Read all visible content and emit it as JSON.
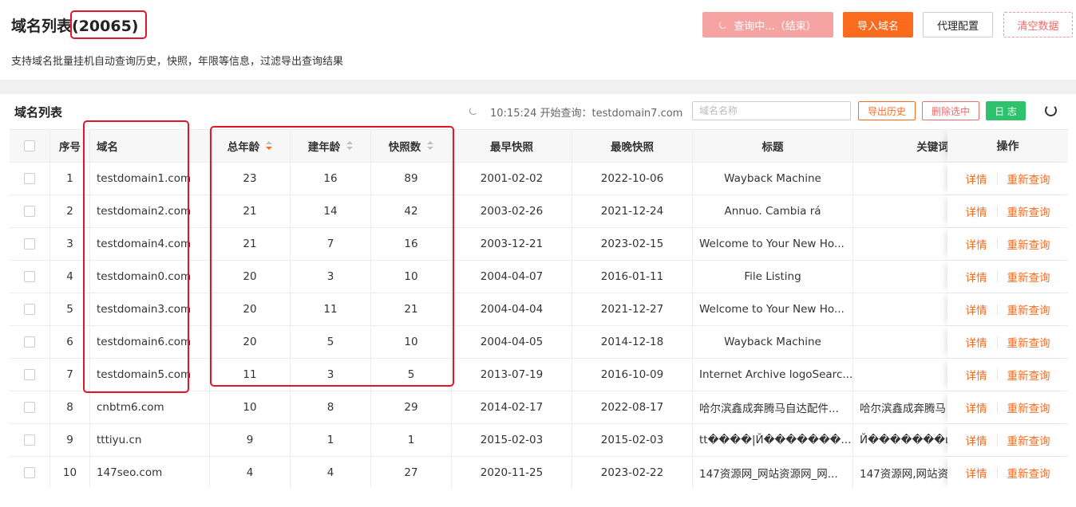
{
  "header": {
    "title": "域名列表",
    "count": "(20065)",
    "description": "支持域名批量挂机自动查询历史，快照，年限等信息，过滤导出查询结果",
    "buttons": {
      "querying": "查询中...（结束）",
      "import": "导入域名",
      "proxy": "代理配置",
      "clear": "清空数据"
    }
  },
  "card": {
    "title": "域名列表",
    "status": "10:15:24 开始查询：testdomain7.com",
    "search_placeholder": "域名名称",
    "buttons": {
      "export": "导出历史",
      "delete": "删除选中",
      "log": "日 志"
    }
  },
  "table": {
    "columns": [
      "序号",
      "域名",
      "总年龄",
      "建年龄",
      "快照数",
      "最早快照",
      "最晚快照",
      "标题",
      "关键词",
      "操作"
    ],
    "sort_state": {
      "总年龄": "desc"
    },
    "actions": {
      "detail": "详情",
      "requery": "重新查询"
    },
    "rows": [
      {
        "no": "1",
        "domain": "testdomain1.com",
        "total_age": "23",
        "build_age": "16",
        "snapshots": "89",
        "earliest": "2001-02-02",
        "latest": "2022-10-06",
        "title": "Wayback Machine",
        "keywords": ""
      },
      {
        "no": "2",
        "domain": "testdomain2.com",
        "total_age": "21",
        "build_age": "14",
        "snapshots": "42",
        "earliest": "2003-02-26",
        "latest": "2021-12-24",
        "title": "Annuo. Cambia rá",
        "keywords": ""
      },
      {
        "no": "3",
        "domain": "testdomain4.com",
        "total_age": "21",
        "build_age": "7",
        "snapshots": "16",
        "earliest": "2003-12-21",
        "latest": "2023-02-15",
        "title": "Welcome to Your New Ho...",
        "keywords": ""
      },
      {
        "no": "4",
        "domain": "testdomain0.com",
        "total_age": "20",
        "build_age": "3",
        "snapshots": "10",
        "earliest": "2004-04-07",
        "latest": "2016-01-11",
        "title": "File Listing",
        "keywords": ""
      },
      {
        "no": "5",
        "domain": "testdomain3.com",
        "total_age": "20",
        "build_age": "11",
        "snapshots": "21",
        "earliest": "2004-04-04",
        "latest": "2021-12-27",
        "title": "Welcome to Your New Ho...",
        "keywords": ""
      },
      {
        "no": "6",
        "domain": "testdomain6.com",
        "total_age": "20",
        "build_age": "5",
        "snapshots": "10",
        "earliest": "2004-04-05",
        "latest": "2014-12-18",
        "title": "Wayback Machine",
        "keywords": ""
      },
      {
        "no": "7",
        "domain": "testdomain5.com",
        "total_age": "11",
        "build_age": "3",
        "snapshots": "5",
        "earliest": "2013-07-19",
        "latest": "2016-10-09",
        "title": "Internet Archive logoSearc...",
        "keywords": ""
      },
      {
        "no": "8",
        "domain": "cnbtm6.com",
        "total_age": "10",
        "build_age": "8",
        "snapshots": "29",
        "earliest": "2014-02-17",
        "latest": "2022-08-17",
        "title": "哈尔滨鑫成奔腾马自达配件...",
        "keywords": "哈尔滨鑫成奔腾马"
      },
      {
        "no": "9",
        "domain": "tttiyu.cn",
        "total_age": "9",
        "build_age": "1",
        "snapshots": "1",
        "earliest": "2015-02-03",
        "latest": "2015-02-03",
        "title": "tt����|Й�������...",
        "keywords": "Й�������щ"
      },
      {
        "no": "10",
        "domain": "147seo.com",
        "total_age": "4",
        "build_age": "4",
        "snapshots": "27",
        "earliest": "2020-11-25",
        "latest": "2023-02-22",
        "title": "147资源网_网站资源网_网...",
        "keywords": "147资源网,网站资"
      }
    ]
  },
  "colors": {
    "accent_orange": "#fa6b1e",
    "annotation_red": "#e0162b",
    "log_green": "#2dc26b"
  }
}
